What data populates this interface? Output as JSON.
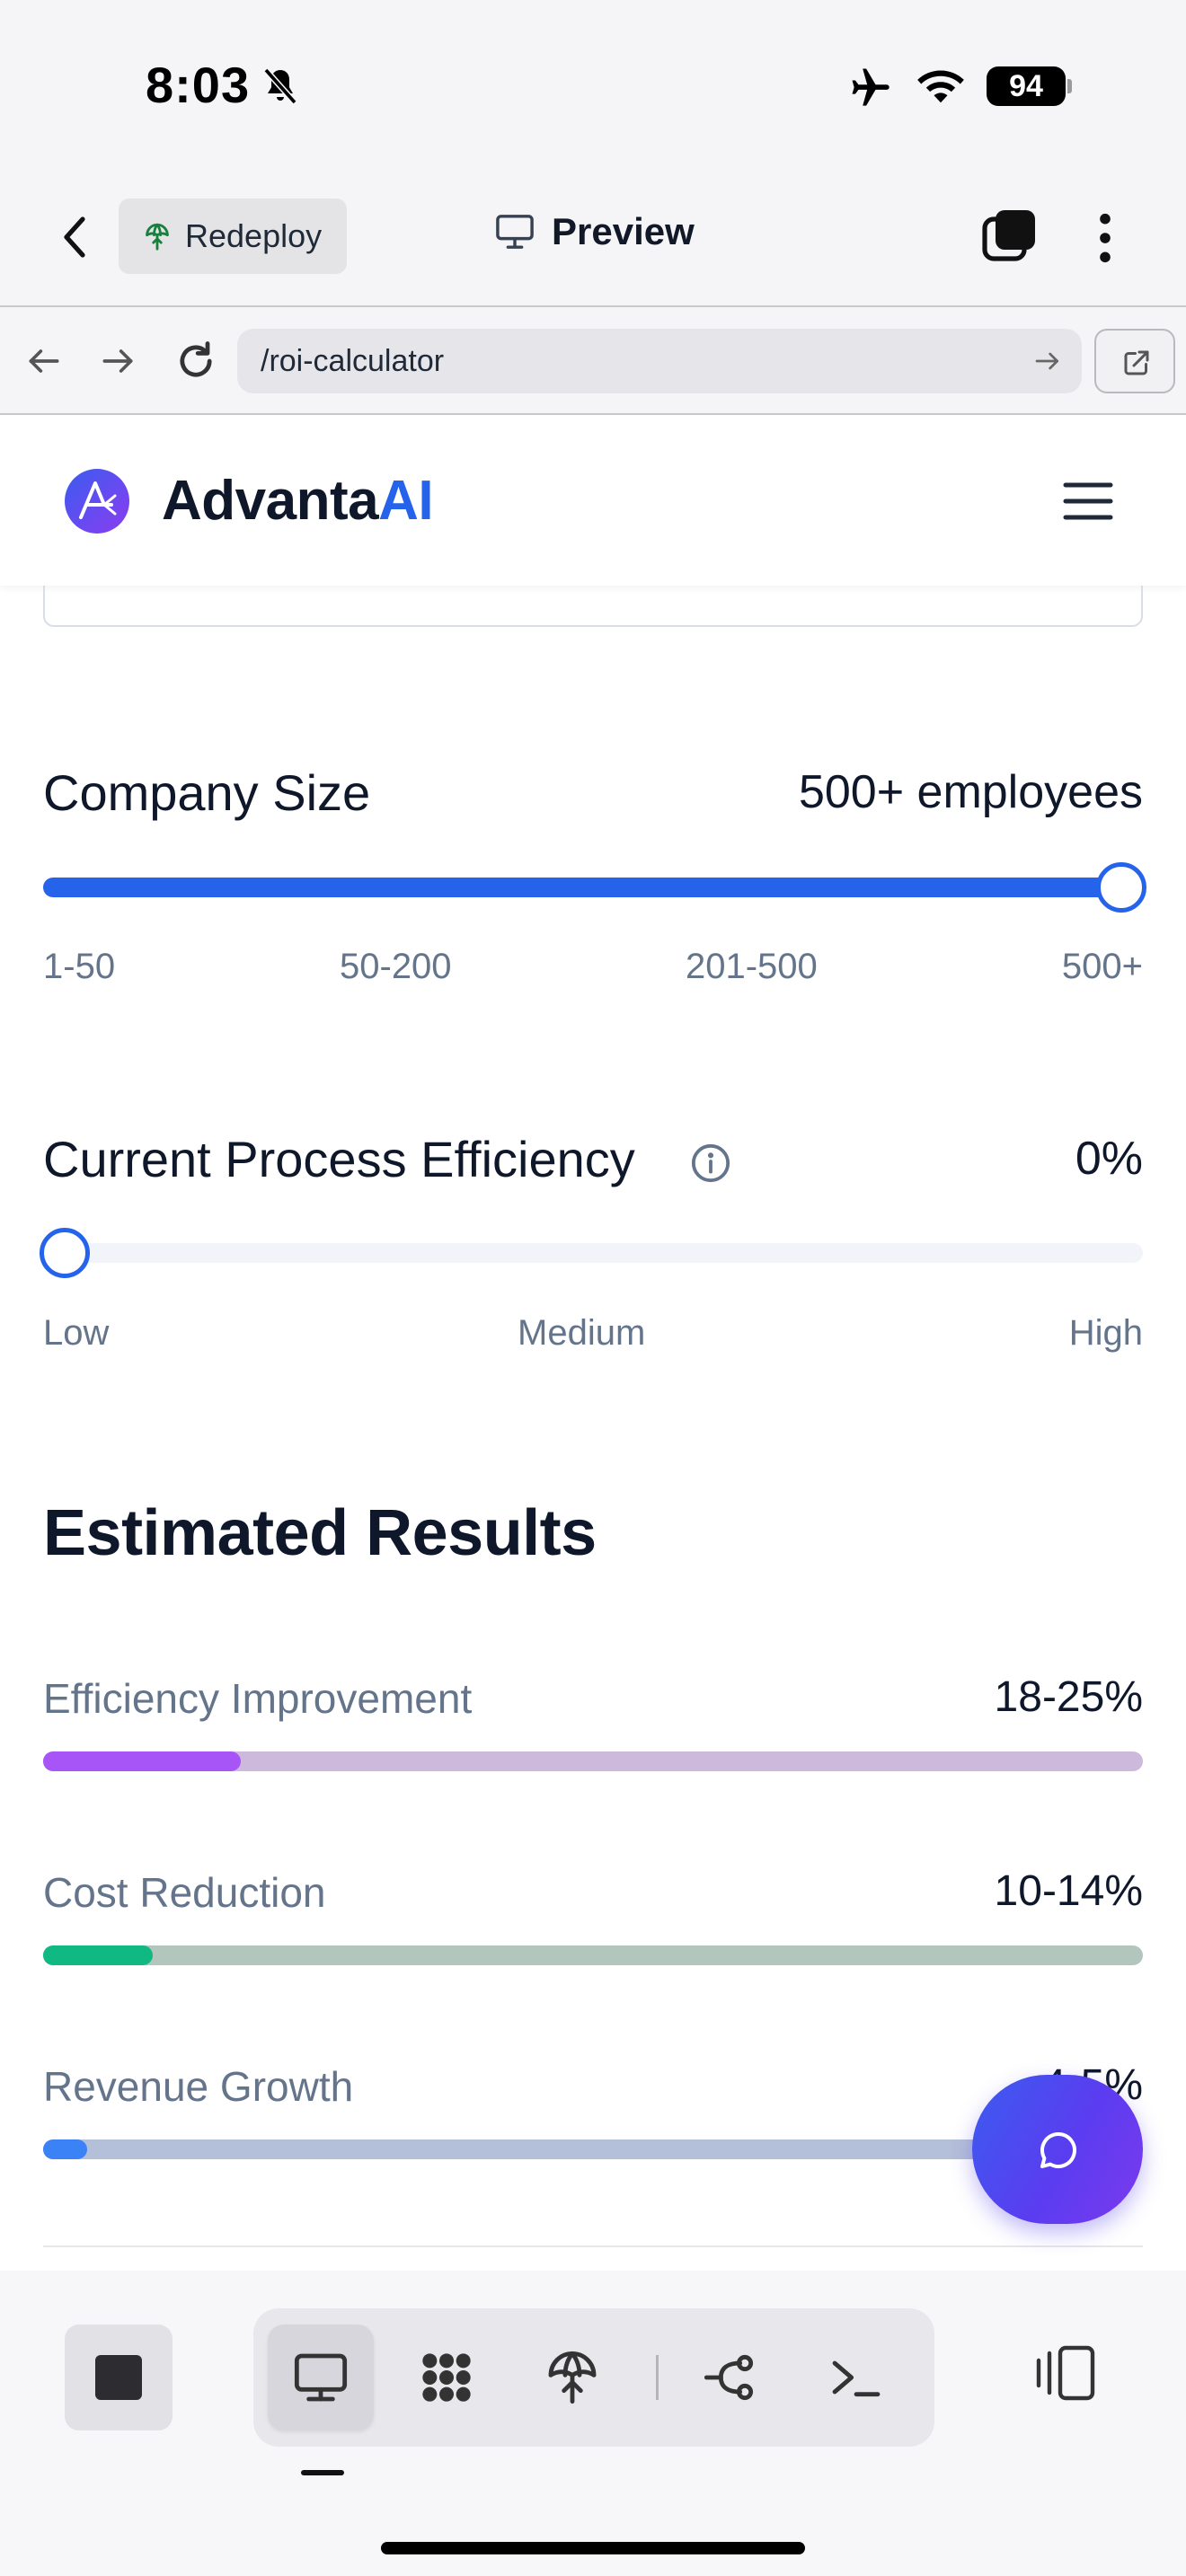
{
  "status_bar": {
    "time": "8:03",
    "battery": "94",
    "icons": [
      "bell-slash-icon",
      "airplane-icon",
      "wifi-icon",
      "battery-icon"
    ]
  },
  "app_bar": {
    "redeploy_label": "Redeploy",
    "preview_label": "Preview",
    "icons": [
      "chevron-left-icon",
      "redeploy-icon",
      "monitor-icon",
      "tabs-icon",
      "more-vertical-icon"
    ]
  },
  "browser": {
    "url": "/roi-calculator",
    "icons": [
      "arrow-left-icon",
      "arrow-right-icon",
      "reload-icon",
      "go-arrow-icon",
      "open-external-icon"
    ]
  },
  "site_header": {
    "brand_main": "Advanta",
    "brand_accent": "AI",
    "icons": [
      "advanta-logo-icon",
      "hamburger-menu-icon"
    ]
  },
  "company_size": {
    "label": "Company Size",
    "value": "500+ employees",
    "slider_fraction": 1.0,
    "ticks": [
      "1-50",
      "50-200",
      "201-500",
      "500+"
    ]
  },
  "efficiency": {
    "label": "Current Process Efficiency",
    "value": "0%",
    "slider_fraction": 0.0,
    "ticks": [
      "Low",
      "Medium",
      "High"
    ]
  },
  "results": {
    "title": "Estimated Results",
    "metrics": [
      {
        "label": "Efficiency Improvement",
        "value": "18-25%",
        "fill_fraction": 0.18,
        "fill_color": "#a855f7",
        "track_color": "#cdb9dc"
      },
      {
        "label": "Cost Reduction",
        "value": "10-14%",
        "fill_fraction": 0.1,
        "fill_color": "#10b981",
        "track_color": "#b3c6bd"
      },
      {
        "label": "Revenue Growth",
        "value": "4-5%",
        "fill_fraction": 0.04,
        "fill_color": "#3b82f6",
        "track_color": "#b4bfd9"
      }
    ]
  },
  "chat": {
    "icon": "chat-bubble-icon"
  },
  "bottom_toolbar": {
    "icons": [
      "stop-icon",
      "desktop-icon",
      "apps-grid-icon",
      "deploy-icon",
      "git-branch-icon",
      "terminal-icon",
      "side-panel-icon"
    ]
  },
  "colors": {
    "accent": "#2563eb",
    "brand_ai": "#2563eb",
    "fab_gradient_start": "#3b5cf0",
    "fab_gradient_end": "#7c3aed"
  }
}
